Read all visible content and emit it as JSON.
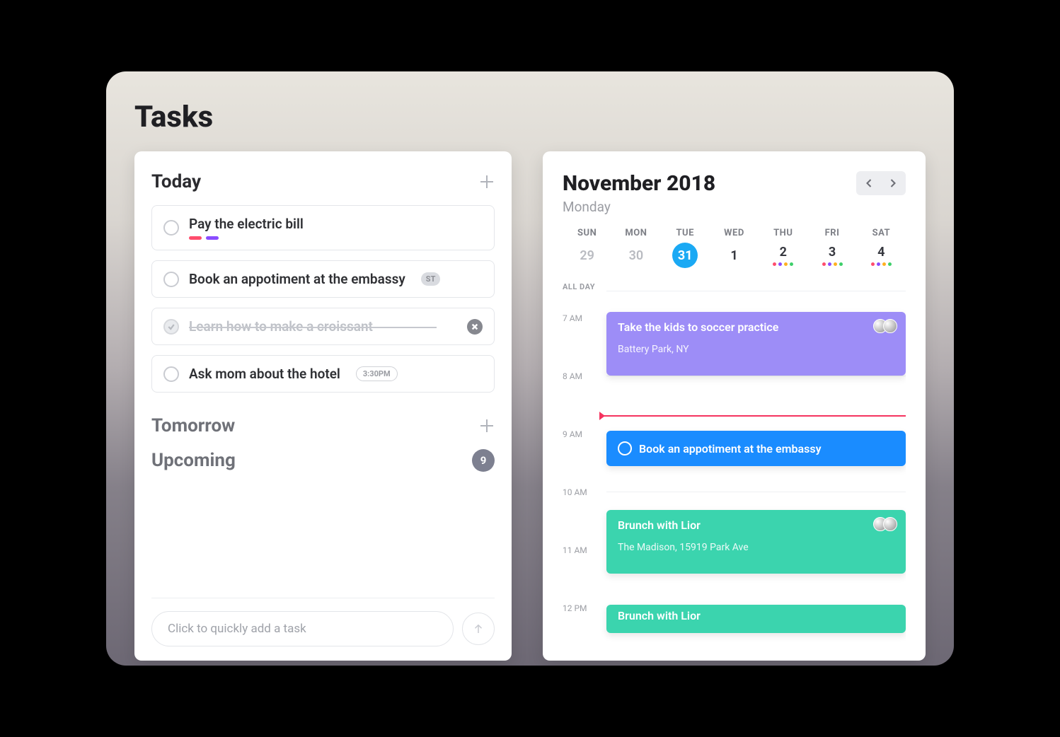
{
  "page": {
    "title": "Tasks"
  },
  "tasks": {
    "today_title": "Today",
    "tomorrow_title": "Tomorrow",
    "upcoming_title": "Upcoming",
    "upcoming_count": "9",
    "items": {
      "t1": {
        "label": "Pay the electric bill"
      },
      "t2": {
        "label": "Book an appotiment at the embassy",
        "badge": "ST"
      },
      "t3": {
        "label": "Learn how to make a croissant"
      },
      "t4": {
        "label": "Ask mom about the hotel",
        "time": "3:30PM"
      }
    },
    "quick_add_placeholder": "Click to quickly add a task"
  },
  "calendar": {
    "month": "November 2018",
    "weekday": "Monday",
    "dow": [
      "SUN",
      "MON",
      "TUE",
      "WED",
      "THU",
      "FRI",
      "SAT"
    ],
    "dates": [
      "29",
      "30",
      "31",
      "1",
      "2",
      "3",
      "4"
    ],
    "allday_label": "ALL DAY",
    "hours": [
      "7 AM",
      "8 AM",
      "9 AM",
      "10 AM",
      "11 AM",
      "12 PM"
    ],
    "events": {
      "e1": {
        "title": "Take the kids to soccer practice",
        "sub": "Battery Park, NY"
      },
      "e2": {
        "title": "Book an appotiment at the embassy"
      },
      "e3": {
        "title": "Brunch with Lior",
        "sub": "The Madison, 15919 Park Ave"
      },
      "e4": {
        "title": "Brunch with Lior"
      }
    }
  },
  "colors": {
    "pink": "#ff4d6d",
    "purple": "#8a4dff",
    "blue": "#1a8cff",
    "violet": "#9d8df7",
    "teal": "#3bd4ae",
    "orange": "#ffb020",
    "green": "#3ecf6a"
  }
}
